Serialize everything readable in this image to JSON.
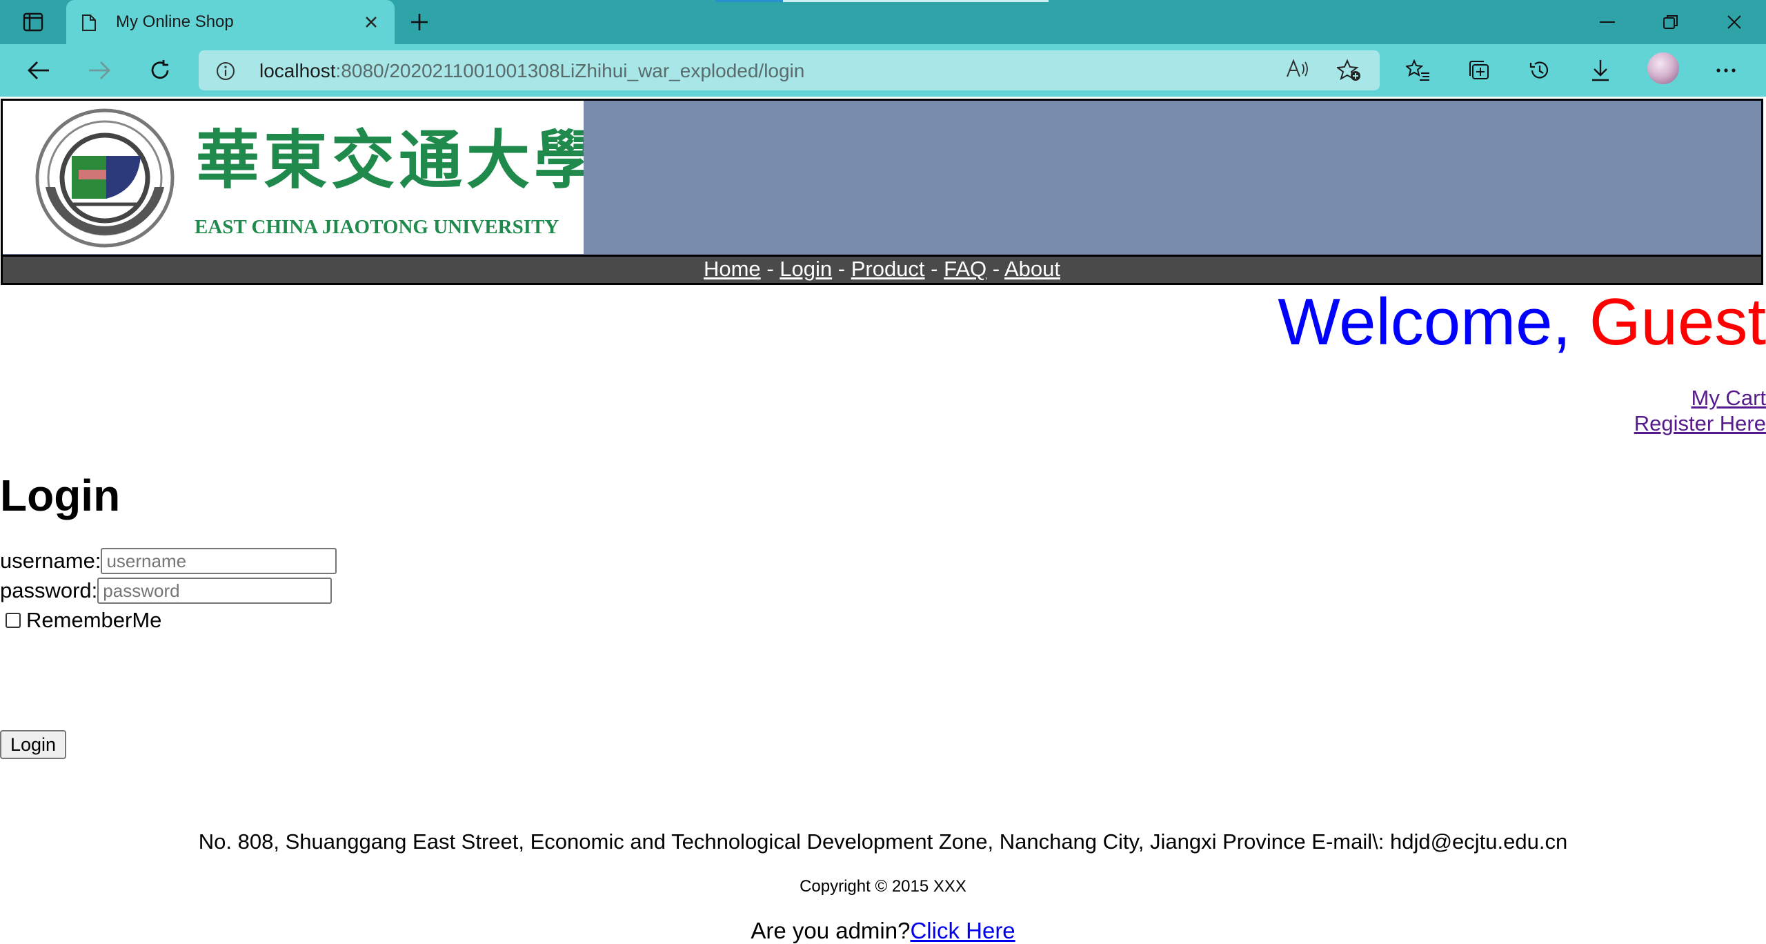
{
  "browser": {
    "tab_title": "My Online Shop",
    "url_host": "localhost",
    "url_rest": ":8080/2020211001001308LiZhihui_war_exploded/login",
    "read_aloud_label": "Aͅ"
  },
  "site": {
    "logo": {
      "cn": "華東交通大學",
      "en": "EAST CHINA JIAOTONG UNIVERSITY",
      "seal_text": "EAST CHINA JIAOTONG UNIVERSITY"
    },
    "nav": {
      "items": [
        "Home",
        "Login",
        "Product",
        "FAQ",
        "About"
      ],
      "separator": "-"
    },
    "welcome": {
      "prefix": "Welcome, ",
      "name": "Guest"
    },
    "links": {
      "cart": "My Cart",
      "register": "Register Here"
    },
    "login": {
      "heading": "Login",
      "username_label": "username:",
      "username_placeholder": "username",
      "password_label": "password:",
      "password_placeholder": "password",
      "remember_label": "RememberMe",
      "button_label": "Login"
    },
    "footer": {
      "address": "No. 808, Shuanggang East Street, Economic and Technological Development Zone, Nanchang City, Jiangxi Province E-mail\\: hdjd@ecjtu.edu.cn",
      "copyright": "Copyright © 2015 XXX",
      "admin_prompt": "Are you admin?",
      "admin_link": "Click Here"
    }
  },
  "colors": {
    "tabbar": "#2ea3a8",
    "toolbar": "#63d4d6",
    "header_bg": "#7a8cab",
    "nav_bg": "#4a4a4a",
    "welcome_blue": "#0000ff",
    "welcome_red": "#ff0000",
    "logo_green": "#1f8a4c"
  }
}
